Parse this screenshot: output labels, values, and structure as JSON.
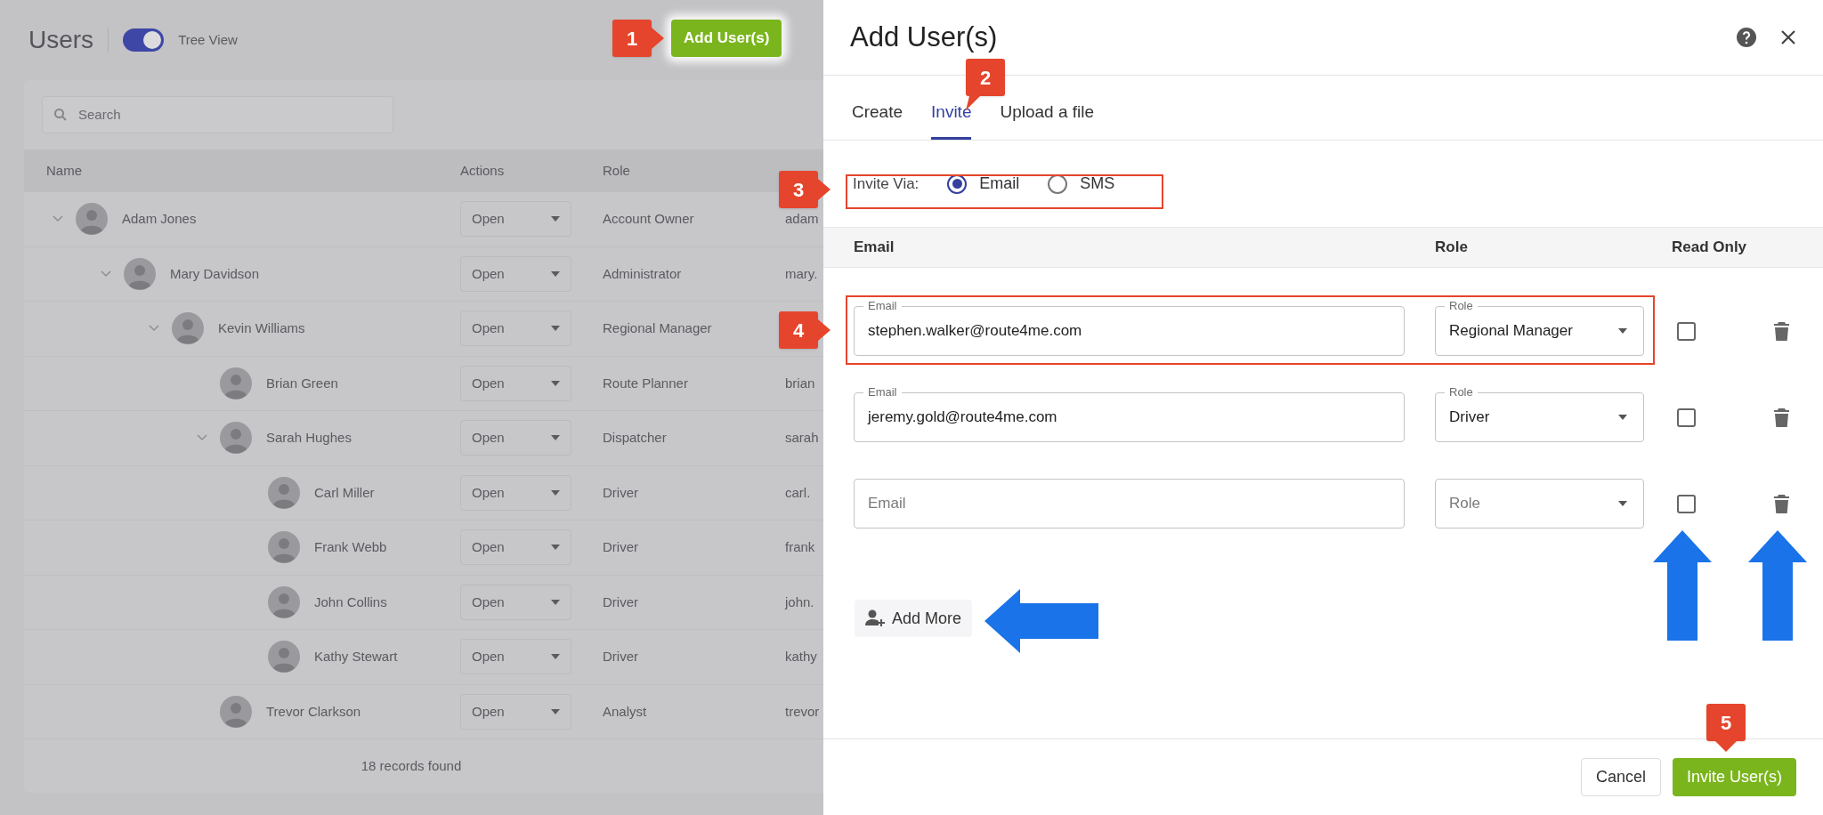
{
  "background": {
    "title": "Users",
    "tree_view": {
      "label": "Tree View",
      "on": true
    },
    "add_button": "Add User(s)",
    "search": {
      "placeholder": "Search"
    },
    "table": {
      "columns": [
        "Name",
        "Actions",
        "Role"
      ],
      "rows": [
        {
          "name": "Adam Jones",
          "action": "Open",
          "role": "Account Owner",
          "column_4": "adam",
          "expanded": true,
          "children": [
            {
              "name": "Mary Davidson",
              "action": "Open",
              "role": "Administrator",
              "column_4": "mary.",
              "expanded": true,
              "children": [
                {
                  "name": "Kevin Williams",
                  "action": "Open",
                  "role": "Regional Manager",
                  "expanded": true,
                  "children": [
                    {
                      "name": "Brian Green",
                      "action": "Open",
                      "role": "Route Planner",
                      "column_4": "brian"
                    },
                    {
                      "name": "Sarah Hughes",
                      "action": "Open",
                      "role": "Dispatcher",
                      "column_4": "sarah",
                      "expanded": true,
                      "children": [
                        {
                          "name": "Carl Miller",
                          "action": "Open",
                          "role": "Driver",
                          "column_4": "carl."
                        },
                        {
                          "name": "Frank Webb",
                          "action": "Open",
                          "role": "Driver",
                          "column_4": "frank"
                        },
                        {
                          "name": "John Collins",
                          "action": "Open",
                          "role": "Driver",
                          "column_4": "john."
                        },
                        {
                          "name": "Kathy Stewart",
                          "action": "Open",
                          "role": "Driver",
                          "column_4": "kathy"
                        }
                      ]
                    },
                    {
                      "name": "Trevor Clarkson",
                      "action": "Open",
                      "role": "Analyst",
                      "column_4": "trevor"
                    }
                  ]
                }
              ]
            }
          ]
        }
      ],
      "footer": "18 records found"
    }
  },
  "dialog": {
    "title": "Add User(s)",
    "tabs": [
      {
        "label": "Create",
        "selected": false
      },
      {
        "label": "Invite",
        "selected": true
      },
      {
        "label": "Upload a file",
        "selected": false
      }
    ],
    "invite_via": {
      "label": "Invite Via:",
      "options": [
        {
          "label": "Email",
          "selected": true
        },
        {
          "label": "SMS",
          "selected": false
        }
      ]
    },
    "columns": [
      "Email",
      "Role",
      "Read Only"
    ],
    "rows": [
      {
        "email": {
          "label": "Email",
          "value": "stephen.walker@route4me.com"
        },
        "role": {
          "label": "Role",
          "value": "Regional Manager"
        },
        "read_only": false
      },
      {
        "email": {
          "label": "Email",
          "value": "jeremy.gold@route4me.com"
        },
        "role": {
          "label": "Role",
          "value": "Driver"
        },
        "read_only": false
      },
      {
        "email": {
          "placeholder": "Email"
        },
        "role": {
          "placeholder": "Role"
        },
        "read_only": false
      }
    ],
    "add_more": "Add More",
    "cancel": "Cancel",
    "submit": "Invite User(s)"
  },
  "callouts": [
    "1",
    "2",
    "3",
    "4",
    "5"
  ]
}
